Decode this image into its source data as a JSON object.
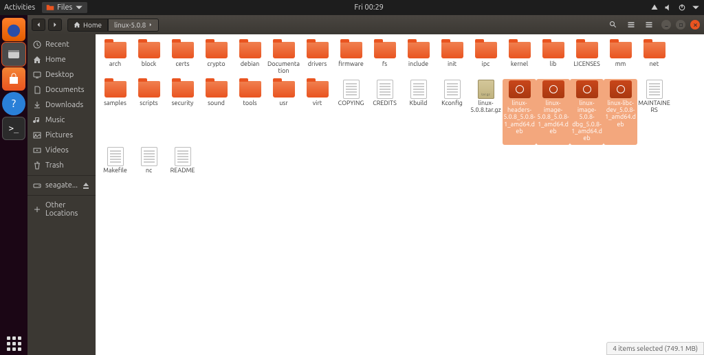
{
  "topbar": {
    "activities": "Activities",
    "app_name": "Files",
    "clock": "Fri 00:29"
  },
  "titlebar": {
    "home_crumb": "Home",
    "folder_crumb": "linux-5.0.8"
  },
  "sidebar": {
    "items": [
      {
        "icon": "clock",
        "label": "Recent"
      },
      {
        "icon": "home",
        "label": "Home"
      },
      {
        "icon": "desktop",
        "label": "Desktop"
      },
      {
        "icon": "documents",
        "label": "Documents"
      },
      {
        "icon": "downloads",
        "label": "Downloads"
      },
      {
        "icon": "music",
        "label": "Music"
      },
      {
        "icon": "pictures",
        "label": "Pictures"
      },
      {
        "icon": "videos",
        "label": "Videos"
      },
      {
        "icon": "trash",
        "label": "Trash"
      }
    ],
    "device": "seagate...",
    "other": "Other Locations"
  },
  "files": [
    {
      "type": "folder",
      "name": "arch"
    },
    {
      "type": "folder",
      "name": "block"
    },
    {
      "type": "folder",
      "name": "certs"
    },
    {
      "type": "folder",
      "name": "crypto"
    },
    {
      "type": "folder",
      "name": "debian"
    },
    {
      "type": "folder",
      "name": "Documentation"
    },
    {
      "type": "folder",
      "name": "drivers"
    },
    {
      "type": "folder",
      "name": "firmware"
    },
    {
      "type": "folder",
      "name": "fs"
    },
    {
      "type": "folder",
      "name": "include"
    },
    {
      "type": "folder",
      "name": "init"
    },
    {
      "type": "folder",
      "name": "ipc"
    },
    {
      "type": "folder",
      "name": "kernel"
    },
    {
      "type": "folder",
      "name": "lib"
    },
    {
      "type": "folder",
      "name": "LICENSES"
    },
    {
      "type": "folder",
      "name": "mm"
    },
    {
      "type": "folder",
      "name": "net"
    },
    {
      "type": "folder",
      "name": "samples"
    },
    {
      "type": "folder",
      "name": "scripts"
    },
    {
      "type": "folder",
      "name": "security"
    },
    {
      "type": "folder",
      "name": "sound"
    },
    {
      "type": "folder",
      "name": "tools"
    },
    {
      "type": "folder",
      "name": "usr"
    },
    {
      "type": "folder",
      "name": "virt"
    },
    {
      "type": "doc",
      "name": "COPYING"
    },
    {
      "type": "doc",
      "name": "CREDITS"
    },
    {
      "type": "doc",
      "name": "Kbuild"
    },
    {
      "type": "doc",
      "name": "Kconfig"
    },
    {
      "type": "arch",
      "name": "linux-5.0.8.tar.gz"
    },
    {
      "type": "deb",
      "name": "linux-headers-5.0.8_5.0.8-1_amd64.deb",
      "selected": true
    },
    {
      "type": "deb",
      "name": "linux-image-5.0.8_5.0.8-1_amd64.deb",
      "selected": true
    },
    {
      "type": "deb",
      "name": "linux-image-5.0.8-dbg_5.0.8-1_amd64.deb",
      "selected": true
    },
    {
      "type": "deb",
      "name": "linux-libc-dev_5.0.8-1_amd64.deb",
      "selected": true
    },
    {
      "type": "doc",
      "name": "MAINTAINERS"
    },
    {
      "type": "doc",
      "name": "Makefile"
    },
    {
      "type": "doc",
      "name": "nc"
    },
    {
      "type": "doc",
      "name": "README"
    }
  ],
  "statusbar": {
    "text": "4 items selected  (749.1 MB)"
  }
}
